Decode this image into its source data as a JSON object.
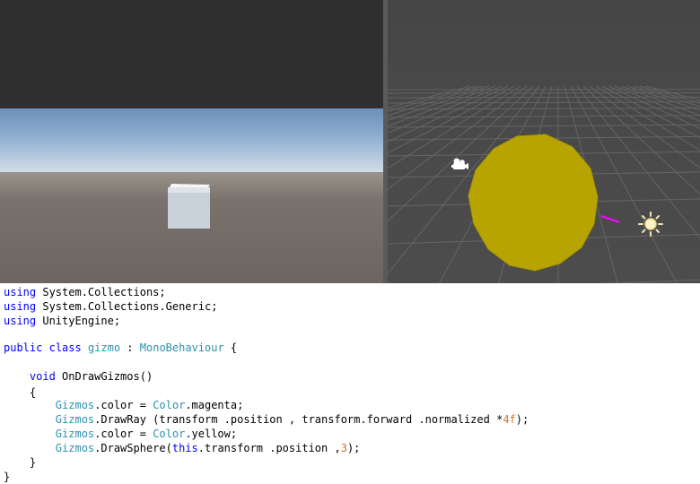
{
  "game_view": {
    "label": "game-view"
  },
  "scene_view": {
    "label": "scene-view"
  },
  "colors": {
    "keyword": "#0000ff",
    "type": "#2b91af",
    "number": "#d4722f",
    "sphere": "#b8a400",
    "ray": "#ff00ff"
  },
  "icons": {
    "camera": "camera-icon",
    "light": "directional-light-icon"
  },
  "code": {
    "lines": [
      [
        {
          "t": "using",
          "c": "kw"
        },
        {
          "t": " System.Collections;",
          "c": ""
        }
      ],
      [
        {
          "t": "using",
          "c": "kw"
        },
        {
          "t": " System.Collections.Generic;",
          "c": ""
        }
      ],
      [
        {
          "t": "using",
          "c": "kw"
        },
        {
          "t": " UnityEngine;",
          "c": ""
        }
      ],
      [],
      [
        {
          "t": "public",
          "c": "kw"
        },
        {
          "t": " ",
          "c": ""
        },
        {
          "t": "class",
          "c": "kw"
        },
        {
          "t": " ",
          "c": ""
        },
        {
          "t": "gizmo",
          "c": "ty"
        },
        {
          "t": " : ",
          "c": ""
        },
        {
          "t": "MonoBehaviour",
          "c": "ty"
        },
        {
          "t": " {",
          "c": ""
        }
      ],
      [],
      [
        {
          "t": "    ",
          "c": ""
        },
        {
          "t": "void",
          "c": "kw"
        },
        {
          "t": " OnDrawGizmos()",
          "c": ""
        }
      ],
      [
        {
          "t": "    {",
          "c": ""
        }
      ],
      [
        {
          "t": "        ",
          "c": ""
        },
        {
          "t": "Gizmos",
          "c": "ty"
        },
        {
          "t": ".color = ",
          "c": ""
        },
        {
          "t": "Color",
          "c": "ty"
        },
        {
          "t": ".magenta;",
          "c": ""
        }
      ],
      [
        {
          "t": "        ",
          "c": ""
        },
        {
          "t": "Gizmos",
          "c": "ty"
        },
        {
          "t": ".DrawRay (transform .position , transform.forward .normalized *",
          "c": ""
        },
        {
          "t": "4f",
          "c": "nm"
        },
        {
          "t": ");",
          "c": ""
        }
      ],
      [
        {
          "t": "        ",
          "c": ""
        },
        {
          "t": "Gizmos",
          "c": "ty"
        },
        {
          "t": ".color = ",
          "c": ""
        },
        {
          "t": "Color",
          "c": "ty"
        },
        {
          "t": ".yellow;",
          "c": ""
        }
      ],
      [
        {
          "t": "        ",
          "c": ""
        },
        {
          "t": "Gizmos",
          "c": "ty"
        },
        {
          "t": ".DrawSphere(",
          "c": ""
        },
        {
          "t": "this",
          "c": "kw"
        },
        {
          "t": ".transform .position ,",
          "c": ""
        },
        {
          "t": "3",
          "c": "nm"
        },
        {
          "t": ");",
          "c": ""
        }
      ],
      [
        {
          "t": "    }",
          "c": ""
        }
      ],
      [
        {
          "t": "}",
          "c": ""
        }
      ]
    ]
  }
}
